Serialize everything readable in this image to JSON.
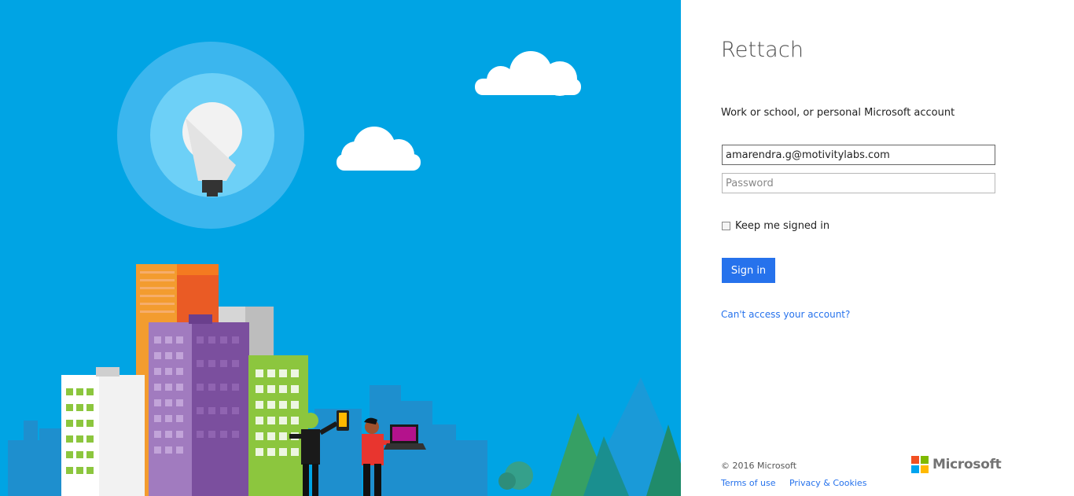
{
  "login": {
    "title": "Rettach",
    "account_label": "Work or school, or personal Microsoft account",
    "email_value": "amarendra.g@motivitylabs.com",
    "password_placeholder": "Password",
    "keep_signed_in_label": "Keep me signed in",
    "keep_signed_in_checked": false,
    "signin_label": "Sign in",
    "cant_access_label": "Can't access your account?"
  },
  "footer": {
    "copyright": "© 2016 Microsoft",
    "terms_label": "Terms of use",
    "privacy_label": "Privacy & Cookies",
    "brand_label": "Microsoft"
  },
  "colors": {
    "hero_background": "#00a4e4",
    "accent": "#2672ec",
    "logo_red": "#f25022",
    "logo_green": "#7fba00",
    "logo_blue": "#00a4ef",
    "logo_yellow": "#ffb900"
  },
  "illustration": {
    "icons": [
      "lightbulb-icon",
      "cloud-icon",
      "cloud-icon",
      "city-skyline",
      "tree-icon",
      "person-with-tablet",
      "person-with-laptop"
    ]
  }
}
